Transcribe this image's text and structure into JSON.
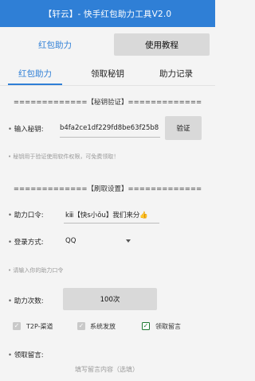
{
  "window": {
    "title": "【轩云】- 快手红包助力工具V2.0"
  },
  "top_buttons": {
    "left_label": "红包助力",
    "right_label": "使用教程"
  },
  "tabs": [
    {
      "label": "红包助力",
      "active": true
    },
    {
      "label": "领取秘钥",
      "active": false
    },
    {
      "label": "助力记录",
      "active": false
    }
  ],
  "key_section": {
    "title": "=============【秘钥验证】=============",
    "input_label": "输入秘钥:",
    "input_value": "b4fa2ce1df229fd8be63f25b8",
    "verify_button": "验证",
    "hint": "秘钥用于验证使用软件权限，可免费领取！"
  },
  "boost_section": {
    "title": "=============【刷取设置】=============",
    "command_label": "助力口令:",
    "command_value": "kⅲ【快s小ǒu】我们来分👍",
    "login_label": "登录方式:",
    "login_value": "QQ",
    "login_hint": "请输入你的助力口令",
    "count_label": "助力次数:",
    "count_button": "100次"
  },
  "checkboxes": [
    {
      "label": "T2P-渠道",
      "checked": false
    },
    {
      "label": "系统发放",
      "checked": false
    },
    {
      "label": "领取留言",
      "checked": true
    }
  ],
  "message": {
    "label": "领取留言:",
    "placeholder": "填写留言内容（选填）"
  },
  "colors": {
    "accent": "#2f7fd6",
    "checkbox_checked": "#1e7a32"
  }
}
